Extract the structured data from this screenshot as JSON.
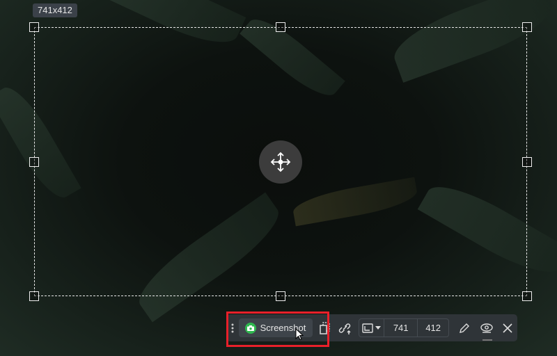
{
  "selection": {
    "size_label": "741x412"
  },
  "toolbar": {
    "screenshot_label": "Screenshot",
    "width_value": "741",
    "height_value": "412"
  },
  "colors": {
    "accent_green": "#2fb84f",
    "highlight_red": "#e8202a",
    "toolbar_bg": "#2f3438"
  }
}
